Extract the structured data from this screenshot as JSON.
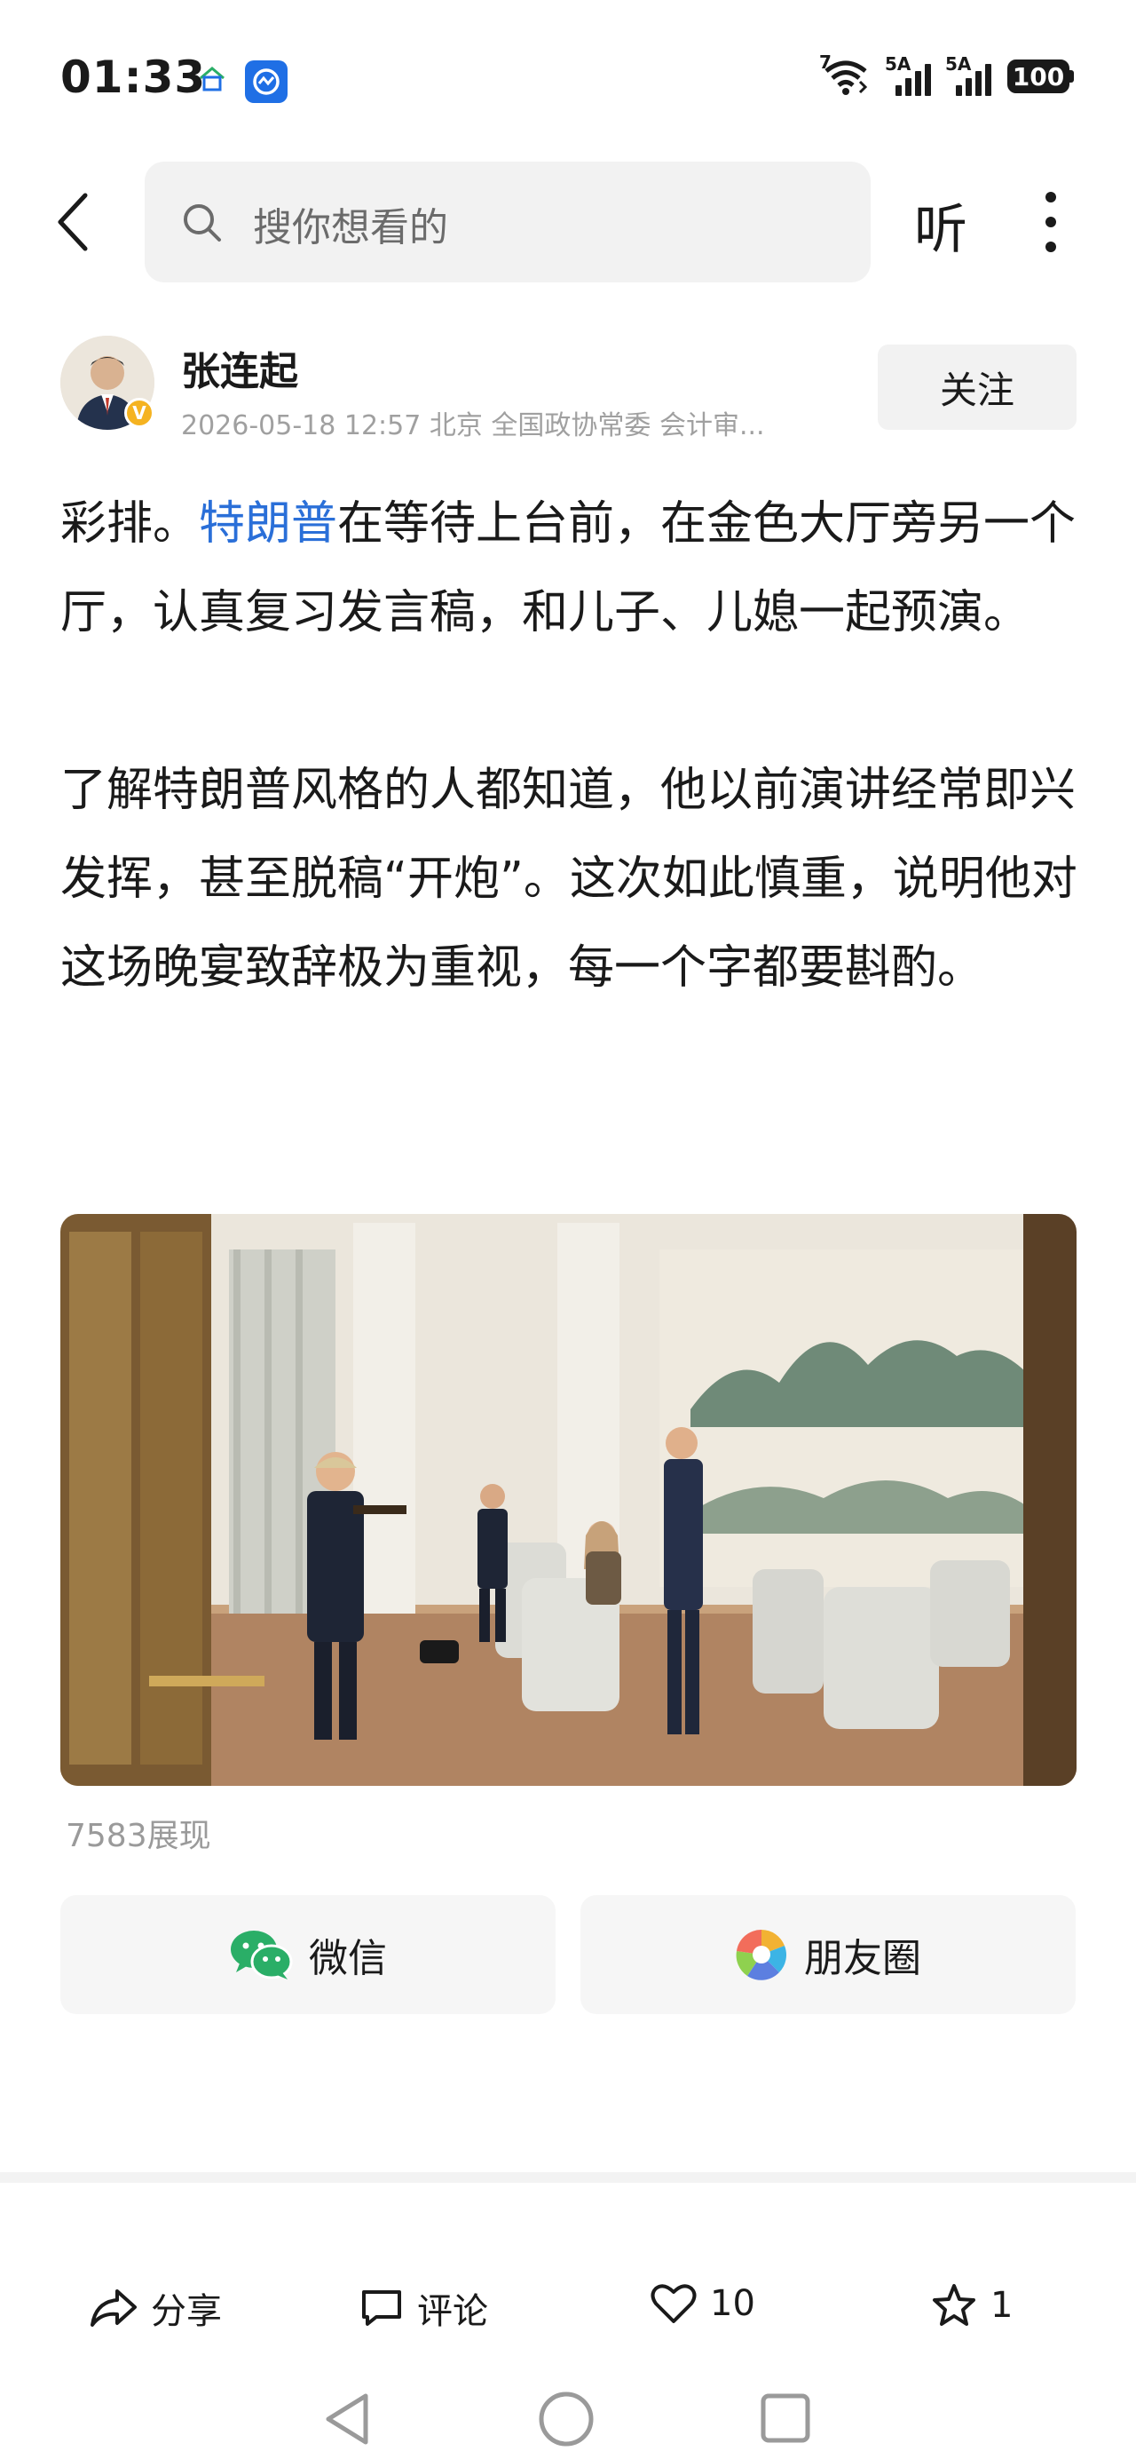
{
  "status_bar": {
    "time": "01:33",
    "signal1_label": "5A",
    "signal2_label": "5A",
    "wifi_label": "7",
    "battery": "100"
  },
  "nav": {
    "search_placeholder": "搜你想看的",
    "listen_label": "听"
  },
  "author": {
    "name": "张连起",
    "meta": "2026-05-18 12:57 北京 全国政协常委 会计审...",
    "verified_badge": "V",
    "follow_label": "关注"
  },
  "article": {
    "p1_before": "彩排。",
    "p1_link": "特朗普",
    "p1_after": "在等待上台前，在金色大厅旁另一个厅，认真复习发言稿，和儿子、儿媳一起预演。",
    "p2": "了解特朗普风格的人都知道，他以前演讲经常即兴发挥，甚至脱稿“开炮”。这次如此慎重，说明他对这场晚宴致辞极为重视，每一个字都要斟酌。"
  },
  "views": "7583展现",
  "share": {
    "wechat": "微信",
    "moments": "朋友圈"
  },
  "actions": {
    "share": "分享",
    "comment": "评论",
    "like_count": "10",
    "fav_count": "1"
  },
  "colors": {
    "accent": "#2a6fd8",
    "wechat_green": "#2aae67",
    "badge": "#f5b321"
  }
}
